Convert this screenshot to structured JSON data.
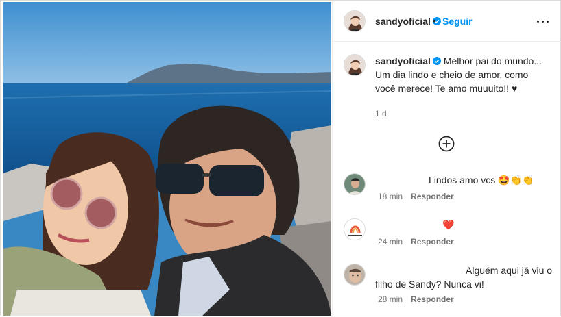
{
  "post": {
    "username": "sandyoficial",
    "follow_label": "Seguir",
    "separator": "•",
    "caption": "Melhor pai do mundo... Um dia lindo e cheio de amor, como você merece! Te amo muuuito!! ♥",
    "caption_age": "1 d"
  },
  "comments": [
    {
      "text": "Lindos amo vcs 🤩👏👏",
      "age": "18 min",
      "reply_label": "Responder"
    },
    {
      "text": "❤️",
      "age": "24 min",
      "reply_label": "Responder",
      "avatar_logo_text": "PENSA + CRIATIVO"
    },
    {
      "text": "Alguém aqui já viu o filho de Sandy? Nunca vi!",
      "age": "28 min",
      "reply_label": "Responder"
    }
  ],
  "colors": {
    "link": "#0095f6",
    "verified": "#0095f6",
    "heart": "#ed4956",
    "muted": "#737373"
  },
  "icons": [
    "verified-badge-icon",
    "more-options-icon",
    "load-more-comments-icon",
    "heart-emoji-icon"
  ]
}
